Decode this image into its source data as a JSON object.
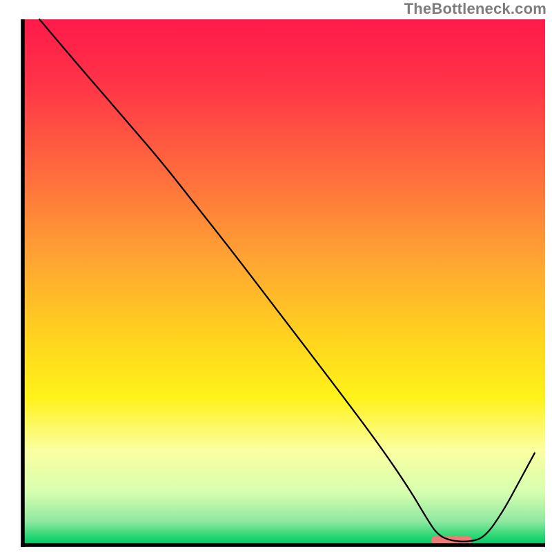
{
  "watermark": "TheBottleneck.com",
  "chart_data": {
    "type": "line",
    "title": "",
    "xlabel": "",
    "ylabel": "",
    "xlim": [
      0,
      100
    ],
    "ylim": [
      0,
      100
    ],
    "background_gradient": {
      "stops": [
        {
          "offset": 0.0,
          "color": "#ff1a4b"
        },
        {
          "offset": 0.12,
          "color": "#ff3347"
        },
        {
          "offset": 0.3,
          "color": "#ff6e3d"
        },
        {
          "offset": 0.45,
          "color": "#ffa233"
        },
        {
          "offset": 0.6,
          "color": "#ffd21f"
        },
        {
          "offset": 0.72,
          "color": "#fff21a"
        },
        {
          "offset": 0.82,
          "color": "#fbffa0"
        },
        {
          "offset": 0.9,
          "color": "#d6ffb0"
        },
        {
          "offset": 0.955,
          "color": "#8fe8a0"
        },
        {
          "offset": 0.985,
          "color": "#22d56f"
        },
        {
          "offset": 1.0,
          "color": "#00c465"
        }
      ]
    },
    "series": [
      {
        "name": "bottleneck-curve",
        "stroke": "#000000",
        "stroke_width": 2.3,
        "x": [
          3.2,
          10.0,
          20.0,
          26.5,
          33.0,
          40.0,
          50.0,
          60.0,
          68.0,
          74.0,
          77.5,
          79.5,
          82.0,
          85.5,
          88.5,
          92.0,
          95.0,
          98.0
        ],
        "y": [
          100.0,
          92.0,
          80.5,
          73.0,
          64.8,
          56.0,
          43.0,
          30.0,
          19.4,
          10.7,
          4.8,
          1.9,
          0.8,
          0.6,
          1.5,
          6.5,
          12.0,
          17.5
        ]
      }
    ],
    "accent_segment": {
      "name": "optimal-zone",
      "fill": "#ef7a78",
      "x_start": 78.2,
      "x_end": 86.0,
      "y_center": 0.9,
      "thickness": 1.6
    },
    "frame": {
      "left_x": 3.2,
      "right_x": 99.0,
      "top_y": 100.0,
      "bottom_y": 0.0,
      "stroke": "#000000",
      "stroke_width": 5.5
    }
  }
}
